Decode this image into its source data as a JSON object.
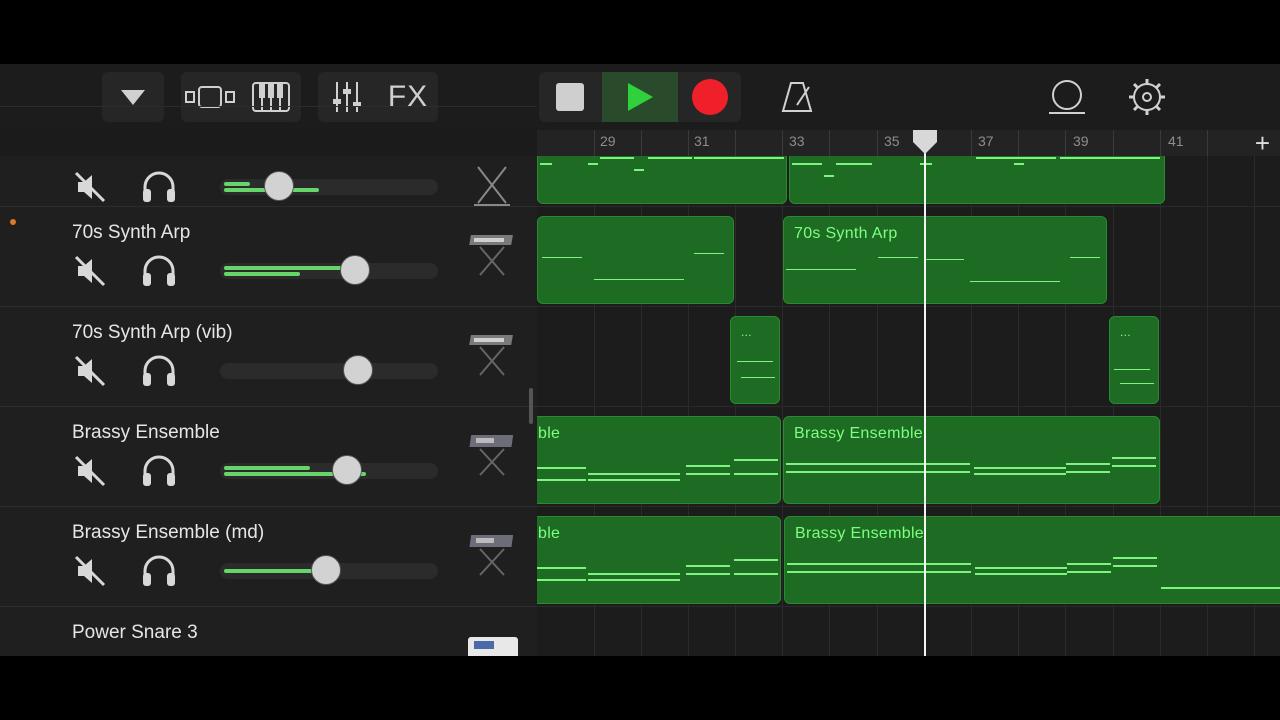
{
  "toolbar": {
    "fx_label": "FX"
  },
  "ruler": {
    "bars": [
      "29",
      "31",
      "33",
      "35",
      "37",
      "39",
      "41"
    ],
    "add_label": "+"
  },
  "tracks": [
    {
      "name": ""
    },
    {
      "name": "70s Synth Arp"
    },
    {
      "name": "70s Synth Arp (vib)"
    },
    {
      "name": "Brassy Ensemble"
    },
    {
      "name": "Brassy Ensemble (md)"
    },
    {
      "name": "Power Snare 3"
    }
  ],
  "regions": {
    "synth_arp_label": "70s Synth Arp",
    "brassy_label": "Brassy Ensemble",
    "brassy_partial_label": "ble",
    "brassy_md_label": "Brassy Ensemble",
    "brassy_md_partial_label": "ble",
    "vib_label_1": "...",
    "vib_label_2": "..."
  },
  "colors": {
    "region_green": "#1e6b23",
    "note_green": "#7cf57e",
    "record_red": "#f0202a",
    "play_green": "#2fd23c",
    "armed_dot": "#d8782d"
  }
}
